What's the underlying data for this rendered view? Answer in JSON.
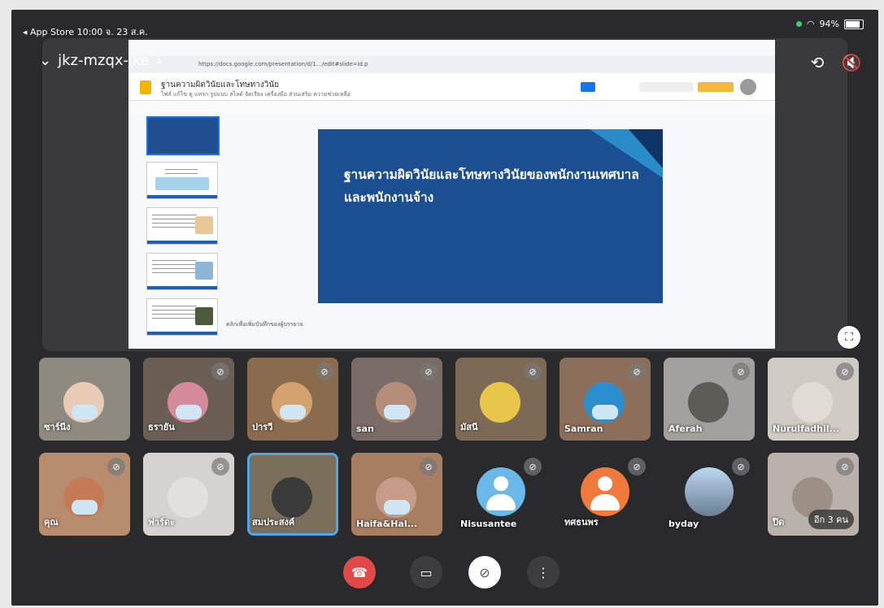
{
  "status": {
    "left": "◂ App Store  10:00  จ. 23 ส.ค.",
    "battery": "94%"
  },
  "meet": {
    "code": "jkz-mzqx-jke",
    "back_icon": "chevron-down-icon",
    "rotate_icon": "camera-switch-icon",
    "mute_all_icon": "speaker-off-icon"
  },
  "presentation": {
    "url": "https://docs.google.com/presentation/d/1…/edit#slide=id.p",
    "doc_title": "ฐานความผิดวินัยและโทษทางวินัย",
    "doc_menu": "ไฟล์  แก้ไข  ดู  แทรก  รูปแบบ  สไลด์  จัดเรียง  เครื่องมือ  ส่วนเสริม  ความช่วยเหลือ",
    "slide_title": "ฐานความผิดวินัยและโทษทางวินัยของพนักงานเทศบาล และพนักงานจ้าง",
    "notes": "คลิกเพื่อเพิ่มบันทึกของผู้บรรยาย"
  },
  "participants": [
    {
      "name": "ซาร์นีง",
      "muted": false
    },
    {
      "name": "ธรายัน",
      "muted": true
    },
    {
      "name": "ปารวี",
      "muted": true
    },
    {
      "name": "san",
      "muted": true
    },
    {
      "name": "มัสนี",
      "muted": true
    },
    {
      "name": "Samran",
      "muted": true
    },
    {
      "name": "Aferah",
      "muted": true
    },
    {
      "name": "Nurulfadhil...",
      "muted": true
    },
    {
      "name": "คุณ",
      "muted": true
    },
    {
      "name": "ฟาร์ดะ",
      "muted": true
    },
    {
      "name": "สมประสงค์",
      "muted": false
    },
    {
      "name": "Haifa&Hal...",
      "muted": true
    },
    {
      "name": "Nisusantee",
      "muted": true
    },
    {
      "name": "ทศธนพร",
      "muted": true
    },
    {
      "name": "byday",
      "muted": true
    },
    {
      "name": "ปิด",
      "muted": true
    }
  ],
  "more_label": "อีก 3 คน",
  "controls": {
    "end_call": "end-call-icon",
    "camera": "camera-icon",
    "mic": "mic-off-icon",
    "more": "more-vertical-icon"
  },
  "colors": {
    "end_call": "#e24a4a",
    "selected_tile": "#4ea7e8",
    "slide_bg": "#1c4e92"
  }
}
